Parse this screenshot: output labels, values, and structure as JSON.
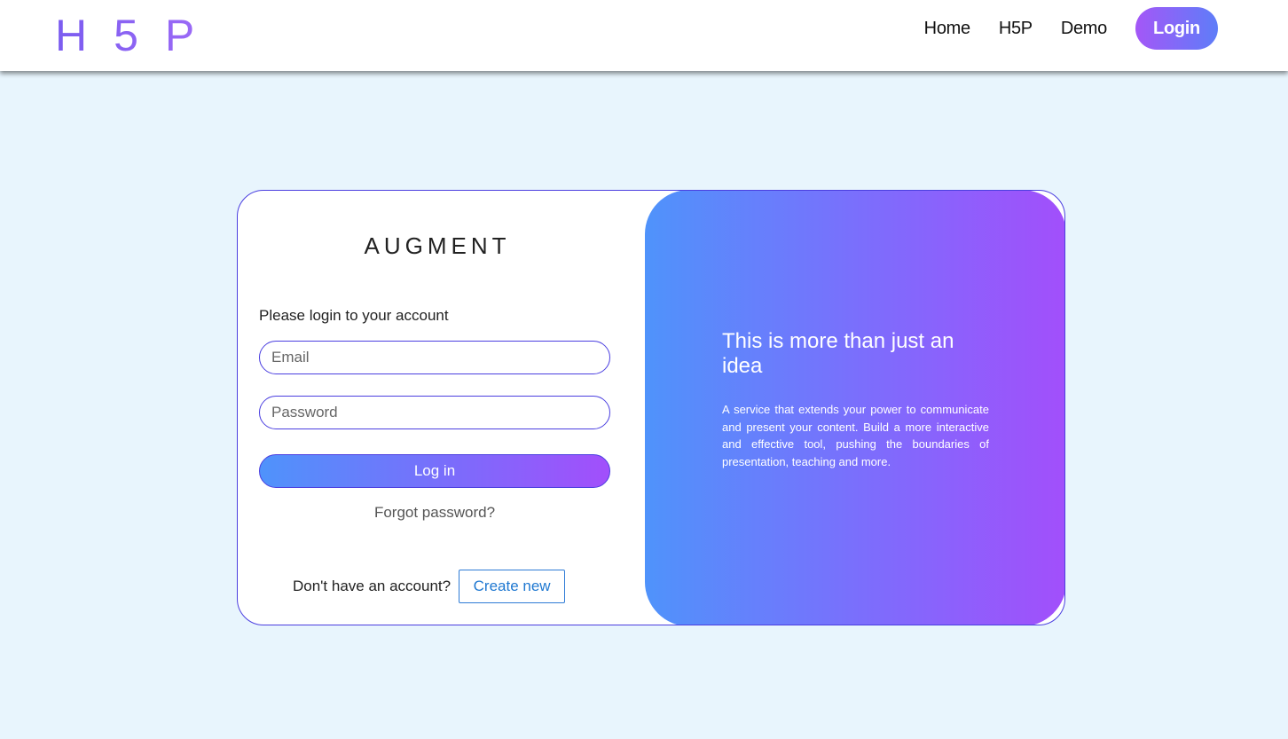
{
  "nav": {
    "logo": "H5P",
    "links": [
      "Home",
      "H5P",
      "Demo"
    ],
    "login_label": "Login"
  },
  "login_card": {
    "brand": "AUGMENT",
    "subtitle": "Please login to your account",
    "email_placeholder": "Email",
    "password_placeholder": "Password",
    "submit_label": "Log in",
    "forgot_label": "Forgot password?",
    "signup_prompt": "Don't have an account?",
    "signup_button": "Create new"
  },
  "promo": {
    "headline": "This is more than just an idea",
    "description": "A service that extends your power to communicate and present your content. Build a more interactive and effective tool, pushing the boundaries of presentation, teaching and more."
  },
  "colors": {
    "accent_blue": "#4f93fb",
    "accent_purple": "#a24ffb",
    "border": "#4b3fe0",
    "background": "#e8f5fd"
  }
}
